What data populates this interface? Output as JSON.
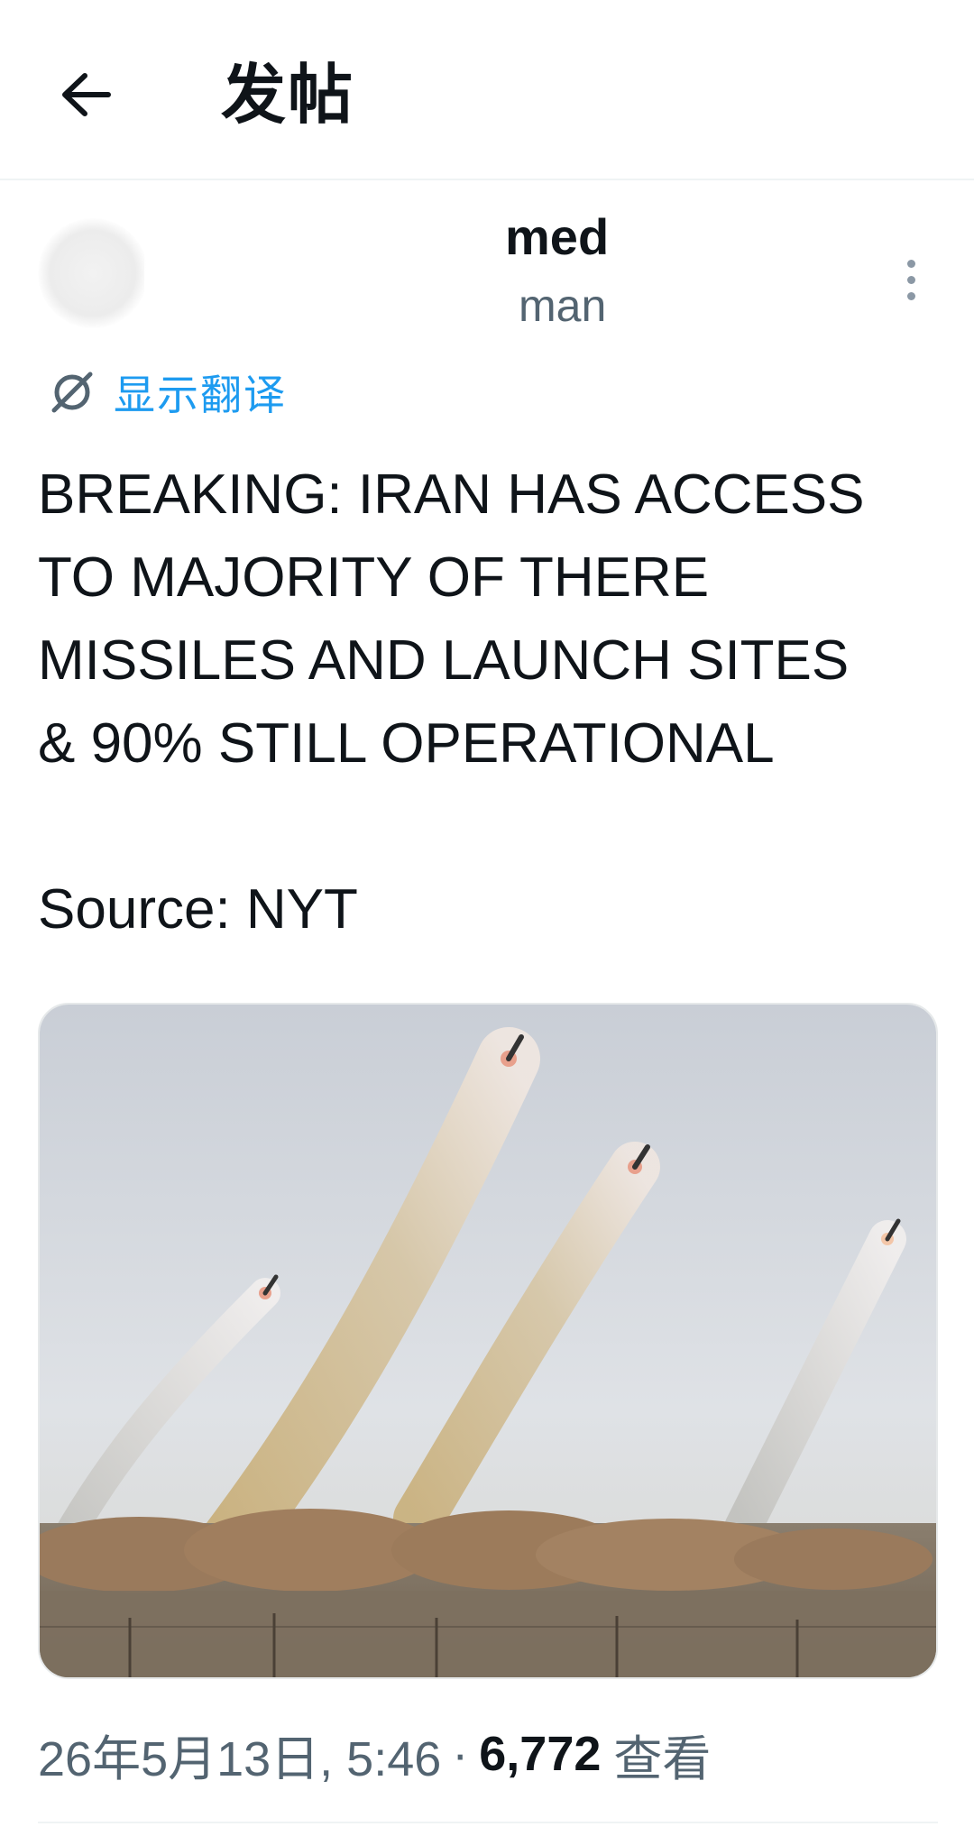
{
  "header": {
    "back_icon": "arrow-left-icon",
    "title": "发帖"
  },
  "author": {
    "display_name": "med",
    "handle": "man",
    "more_icon": "more-vertical-icon"
  },
  "translate": {
    "icon": "translate-icon",
    "label": "显示翻译"
  },
  "tweet": {
    "text": "BREAKING: IRAN HAS ACCESS\nTO MAJORITY OF THERE\nMISSILES AND LAUNCH SITES\n& 90% STILL OPERATIONAL\n\nSource: NYT"
  },
  "media": {
    "icon": "photo-missile-launch"
  },
  "meta": {
    "date_time": "26年5月13日, 5:46",
    "separator": "·",
    "views_count": "6,772",
    "views_label": "查看"
  },
  "colors": {
    "text_primary": "#0f1419",
    "text_secondary": "#536471",
    "accent": "#1d9bf0",
    "divider": "#eff3f4"
  }
}
